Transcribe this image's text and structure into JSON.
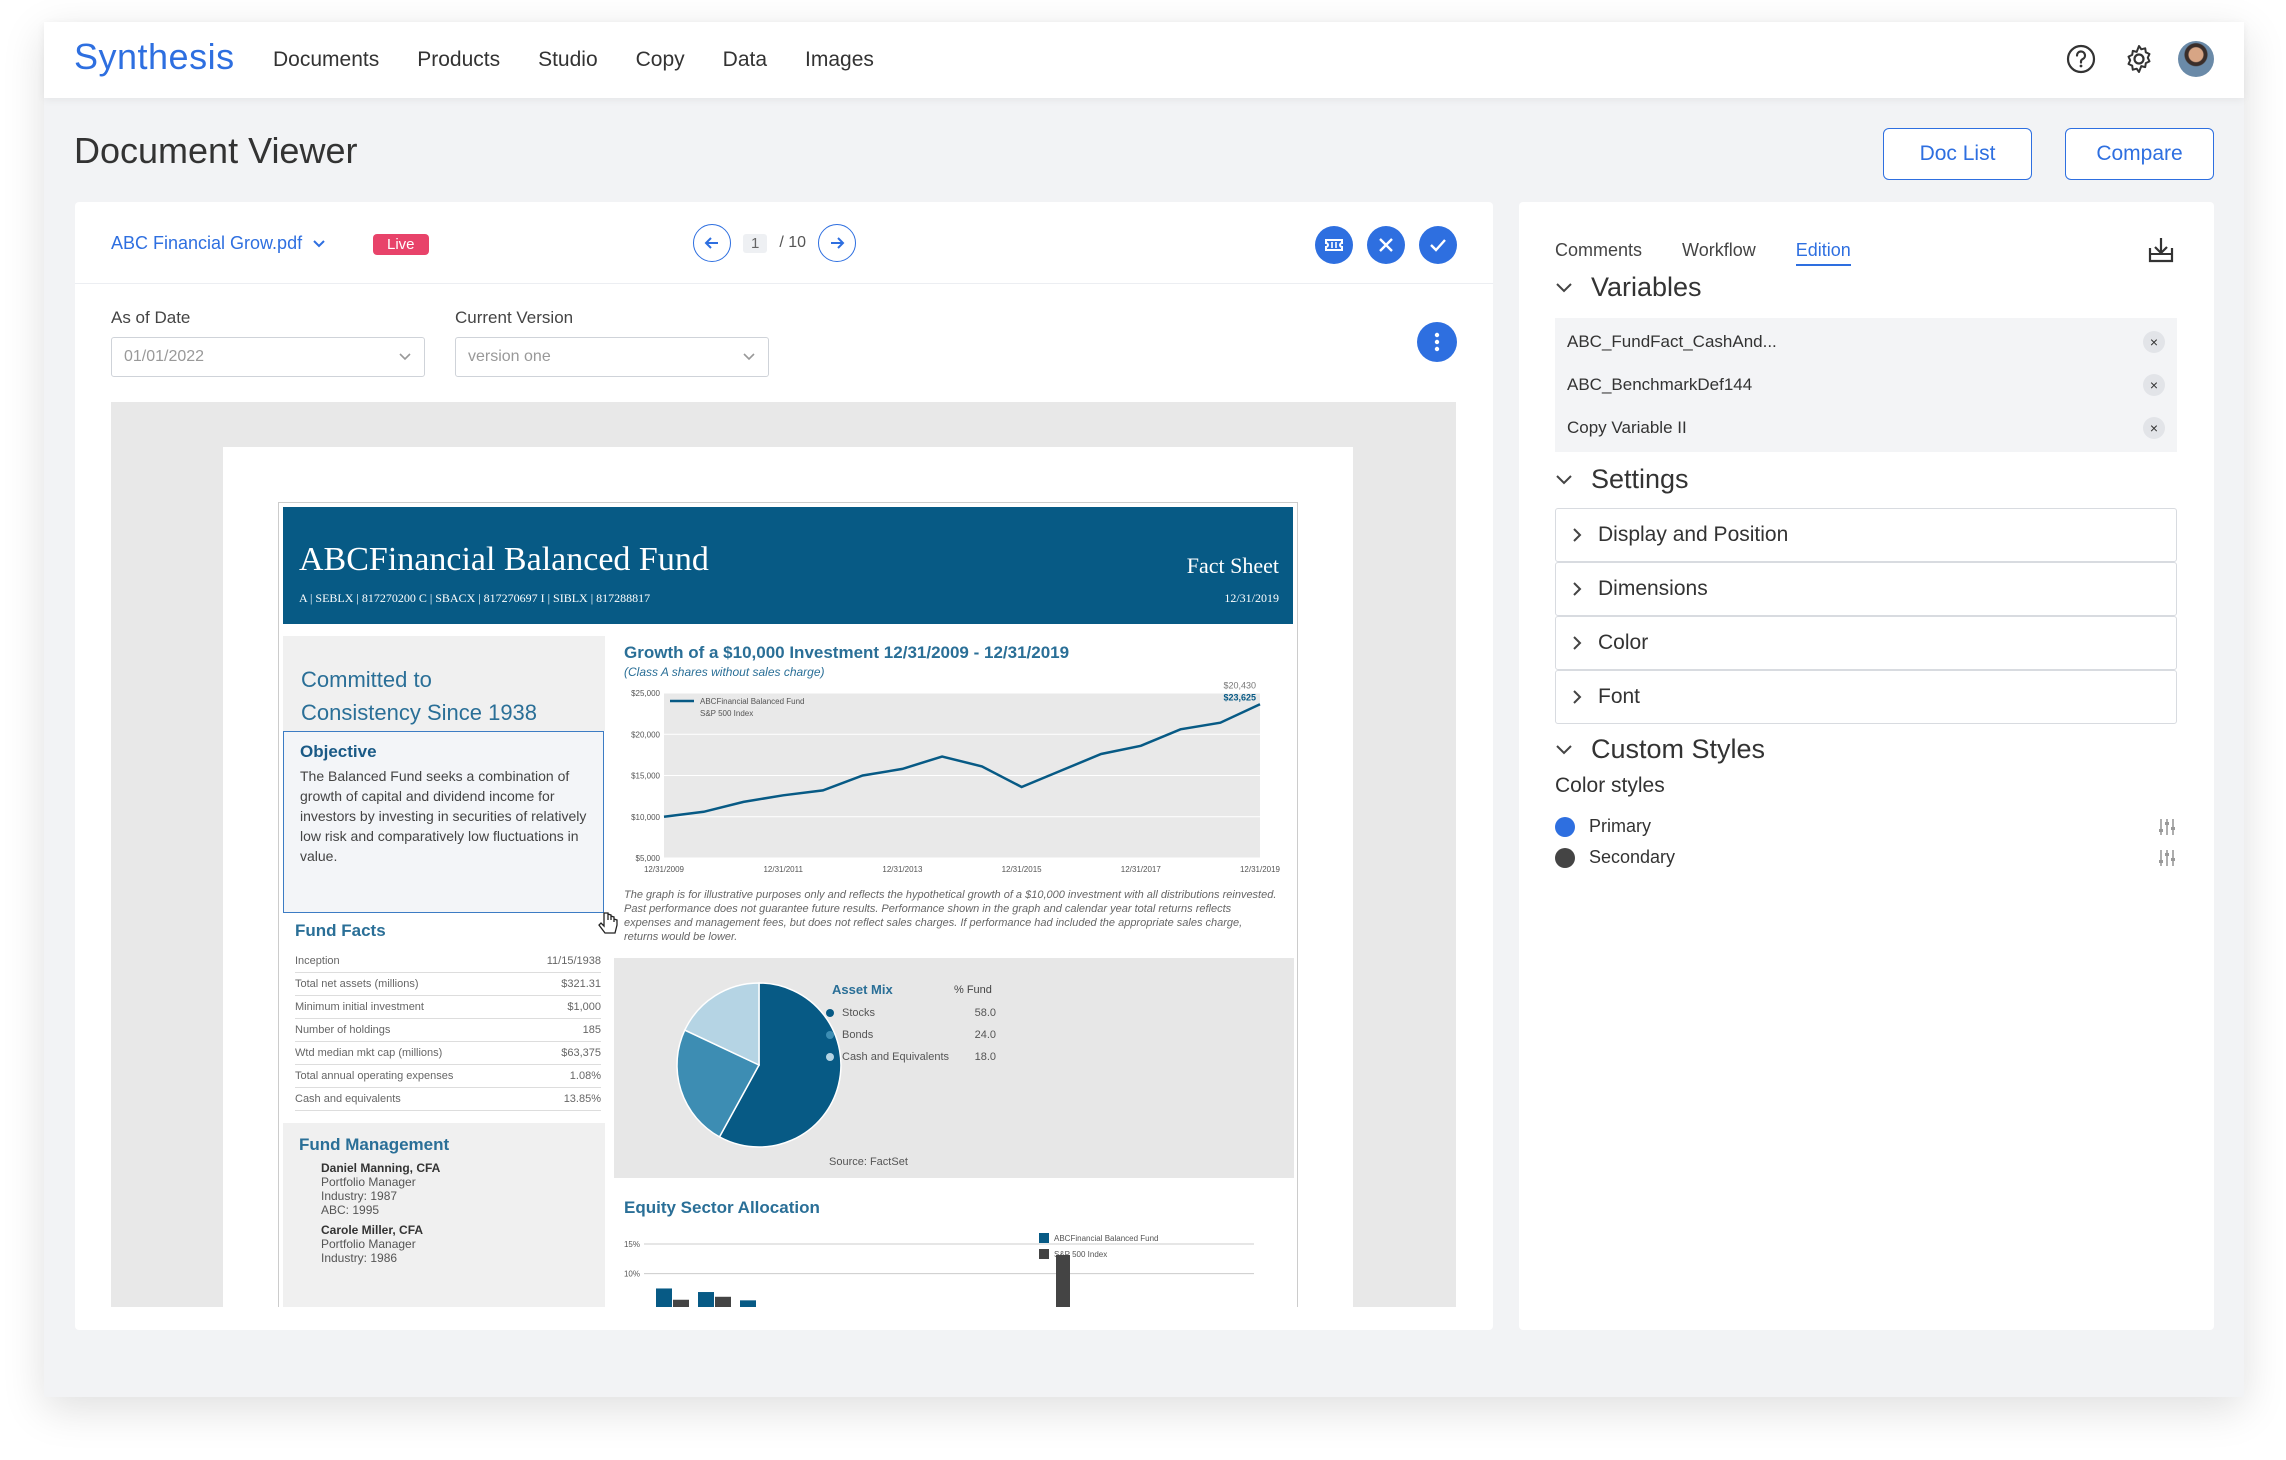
{
  "app": {
    "brand": "Synthesis",
    "nav": [
      "Documents",
      "Products",
      "Studio",
      "Copy",
      "Data",
      "Images"
    ]
  },
  "page": {
    "title": "Document Viewer",
    "doc_list_label": "Doc List",
    "compare_label": "Compare"
  },
  "viewer": {
    "file_name": "ABC Financial Grow.pdf",
    "status": "Live",
    "page_current": "1",
    "page_total": "/ 10",
    "as_of_date_label": "As of Date",
    "as_of_date_value": "01/01/2022",
    "version_label": "Current Version",
    "version_value": "version one"
  },
  "document": {
    "title": "ABCFinancial Balanced Fund",
    "subtitle": "A  |  SEBLX  |  817270200     C  |  SBACX  |  817270697     I  |  SIBLX  |  817288817",
    "fact_sheet": "Fact Sheet",
    "date": "12/31/2019",
    "committed": "Committed to",
    "consistency": "Consistency Since 1938",
    "objective_title": "Objective",
    "objective_text": "The Balanced Fund seeks a combination of growth of capital and dividend income for investors by investing in securities of relatively low risk and comparatively low fluctuations in value.",
    "fund_facts_title": "Fund Facts",
    "fund_facts": [
      [
        "Inception",
        "11/15/1938"
      ],
      [
        "Total net assets (millions)",
        "$321.31"
      ],
      [
        "Minimum initial investment",
        "$1,000"
      ],
      [
        "Number of holdings",
        "185"
      ],
      [
        "Wtd median mkt cap (millions)",
        "$63,375"
      ],
      [
        "Total annual operating expenses",
        "1.08%"
      ],
      [
        "Cash and equivalents",
        "13.85%"
      ]
    ],
    "mgmt_title": "Fund Management",
    "managers": [
      [
        "Daniel Manning, CFA",
        "Portfolio Manager",
        "Industry: 1987",
        "ABC: 1995"
      ],
      [
        "Carole Miller, CFA",
        "Portfolio Manager",
        "Industry: 1986"
      ]
    ],
    "growth_title": "Growth of a $10,000 Investment 12/31/2009 - 12/31/2019",
    "growth_sub": "(Class A shares without sales charge)",
    "growth_note": "The graph is for illustrative purposes only and reflects the hypothetical growth of a $10,000 investment with all distributions reinvested. Past performance does not guarantee future results. Performance shown in the graph and calendar year total returns reflects expenses and management fees, but does not reflect sales charges. If performance had included the appropriate sales charge, returns would be lower.",
    "asset_mix_title": "Asset Mix",
    "asset_mix_pct": "% Fund",
    "asset_mix": [
      {
        "label": "Stocks",
        "value": "58.0",
        "color": "#075a85"
      },
      {
        "label": "Bonds",
        "value": "24.0",
        "color": "#3d8db3"
      },
      {
        "label": "Cash and Equivalents",
        "value": "18.0",
        "color": "#b5d4e4"
      }
    ],
    "source": "Source: FactSet",
    "equity_title": "Equity Sector Allocation",
    "equity_legend": [
      "ABCFinancial Balanced Fund",
      "S&P 500 Index"
    ]
  },
  "chart_data": [
    {
      "type": "line",
      "title": "Growth of a $10,000 Investment 12/31/2009 - 12/31/2019",
      "x": [
        "12/31/2009",
        "12/31/2011",
        "12/31/2013",
        "12/31/2015",
        "12/31/2017",
        "12/31/2019"
      ],
      "yticks": [
        "$25,000",
        "$20,000",
        "$15,000",
        "$10,000",
        "$5,000"
      ],
      "ylim": [
        5000,
        25000
      ],
      "series": [
        {
          "name": "ABCFinancial Balanced Fund",
          "end_label": "$23,625",
          "values": [
            10000,
            10600,
            11800,
            12600,
            13200,
            15000,
            15800,
            17300,
            16100,
            13600,
            15600,
            17600,
            18600,
            20600,
            21400,
            23625
          ]
        },
        {
          "name": "S&P 500 Index",
          "end_label": "$20,430"
        }
      ]
    },
    {
      "type": "pie",
      "categories": [
        "Stocks",
        "Bonds",
        "Cash and Equivalents"
      ],
      "values": [
        58.0,
        24.0,
        18.0
      ]
    },
    {
      "type": "bar",
      "title": "Equity Sector Allocation",
      "yticks": [
        "15%",
        "10%"
      ],
      "series": [
        {
          "name": "ABCFinancial Balanced Fund",
          "values": [
            7.5,
            6.9,
            5.5,
            0,
            0
          ]
        },
        {
          "name": "S&P 500 Index",
          "values": [
            5.6,
            6.1,
            0,
            3.6,
            3.6
          ]
        }
      ]
    }
  ],
  "panel": {
    "tabs": [
      "Comments",
      "Workflow",
      "Edition"
    ],
    "variables_title": "Variables",
    "variables": [
      "ABC_FundFact_CashAnd...",
      "ABC_BenchmarkDef144",
      "Copy Variable II"
    ],
    "settings_title": "Settings",
    "settings": [
      "Display and Position",
      "Dimensions",
      "Color",
      "Font"
    ],
    "custom_styles_title": "Custom Styles",
    "color_styles_label": "Color styles",
    "color_styles": [
      {
        "name": "Primary",
        "color": "#2e6fe0"
      },
      {
        "name": "Secondary",
        "color": "#444444"
      }
    ]
  }
}
